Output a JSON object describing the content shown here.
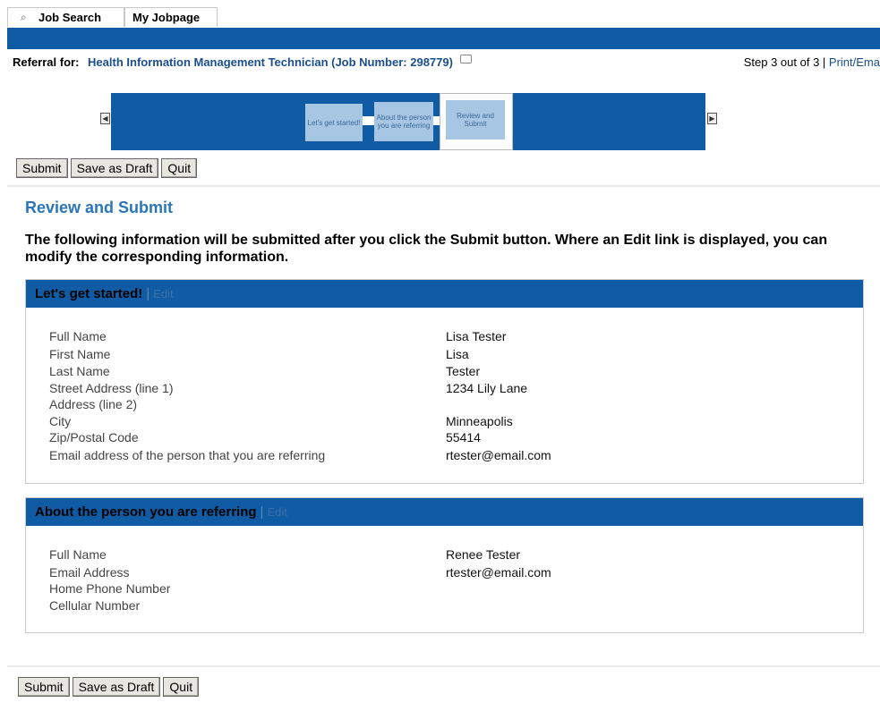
{
  "tabs": [
    {
      "label": "Job Search",
      "icon": "search-icon"
    },
    {
      "label": "My Jobpage"
    }
  ],
  "header": {
    "referral_label": "Referral for:",
    "job_title": "Health Information Management Technician (Job Number: 298779)",
    "step": "Step 3 out of 3 |",
    "print_link": "Print/Ema"
  },
  "wizard": {
    "steps": [
      "Let's get started!",
      "About the person you are referring",
      "Review and Submit"
    ],
    "current_step": 3
  },
  "buttons": {
    "submit": "Submit",
    "save_draft": "Save as Draft",
    "quit": "Quit"
  },
  "page": {
    "title": "Review and Submit",
    "intro": "The following information will be submitted after you click the Submit button. Where an Edit link is displayed, you can modify the corresponding information."
  },
  "sections": [
    {
      "title": "Let's get started!",
      "separator": "|",
      "edit": "Edit",
      "fields": [
        {
          "label": "Full Name",
          "value": "Lisa Tester"
        },
        {
          "label": "First Name",
          "value": "Lisa"
        },
        {
          "label": "Last Name",
          "value": "Tester"
        },
        {
          "label": "Street Address (line 1)",
          "value": "1234 Lily Lane"
        },
        {
          "label": "Address (line 2)",
          "value": ""
        },
        {
          "label": "City",
          "value": "Minneapolis"
        },
        {
          "label": "Zip/Postal Code",
          "value": "55414"
        },
        {
          "label": "Email address of the person that you are referring",
          "value": "rtester@email.com"
        }
      ]
    },
    {
      "title": "About the person you are referring",
      "separator": "|",
      "edit": "Edit",
      "fields": [
        {
          "label": "Full Name",
          "value": "Renee Tester"
        },
        {
          "label": "Email Address",
          "value": "rtester@email.com"
        },
        {
          "label": "Home Phone Number",
          "value": ""
        },
        {
          "label": "Cellular Number",
          "value": ""
        }
      ]
    }
  ],
  "colors": {
    "brand_blue": "#0f5ba4",
    "heading_blue": "#2a76b8",
    "link_blue": "#1a4f8f"
  }
}
